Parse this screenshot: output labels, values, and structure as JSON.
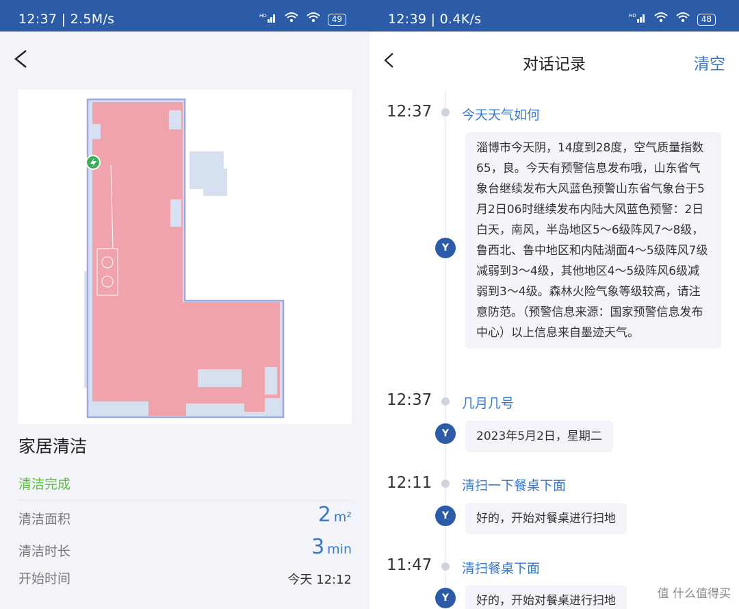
{
  "left": {
    "status_bar": {
      "time": "12:37 | 2.5M/s",
      "signal": "HD",
      "battery": "49"
    },
    "page_title": "家居清洁",
    "status_text": "清洁完成",
    "stats": [
      {
        "label": "清洁面积",
        "value": "2",
        "unit": "m²"
      },
      {
        "label": "清洁时长",
        "value": "3",
        "unit": "min"
      },
      {
        "label": "开始时间",
        "value": "今天 12:12"
      }
    ]
  },
  "right": {
    "status_bar": {
      "time": "12:39 | 0.4K/s",
      "signal": "HD",
      "battery": "48"
    },
    "title": "对话记录",
    "clear_label": "清空",
    "avatar_letter": "Y",
    "conversations": [
      {
        "time": "12:37",
        "question": "今天天气如何",
        "answer": "淄博市今天阴，14度到28度，空气质量指数65，良。今天有预警信息发布哦，山东省气象台继续发布大风蓝色预警山东省气象台于5月2日06时继续发布内陆大风蓝色预警：2日白天，南风，半岛地区5～6级阵风7～8级，鲁西北、鲁中地区和内陆湖面4～5级阵风7级减弱到3～4级，其他地区4～5级阵风6级减弱到3～4级。森林火险气象等级较高，请注意防范。（预警信息来源：国家预警信息发布中心）以上信息来自墨迹天气。"
      },
      {
        "time": "12:37",
        "question": "几月几号",
        "answer": "2023年5月2日，星期二"
      },
      {
        "time": "12:11",
        "question": "清扫一下餐桌下面",
        "answer": "好的，开始对餐桌进行扫地"
      },
      {
        "time": "11:47",
        "question": "清扫餐桌下面",
        "answer": "好的，开始对餐桌进行扫地"
      }
    ],
    "watermark": "值 什么值得买"
  },
  "colors": {
    "status_bar": "#2c5ca7",
    "accent": "#3a78c9",
    "success": "#5cbf3a",
    "map_cleaned": "#f0a3ad",
    "map_outline": "#9fa6e0",
    "map_uncleaned": "#d6e0f0"
  }
}
